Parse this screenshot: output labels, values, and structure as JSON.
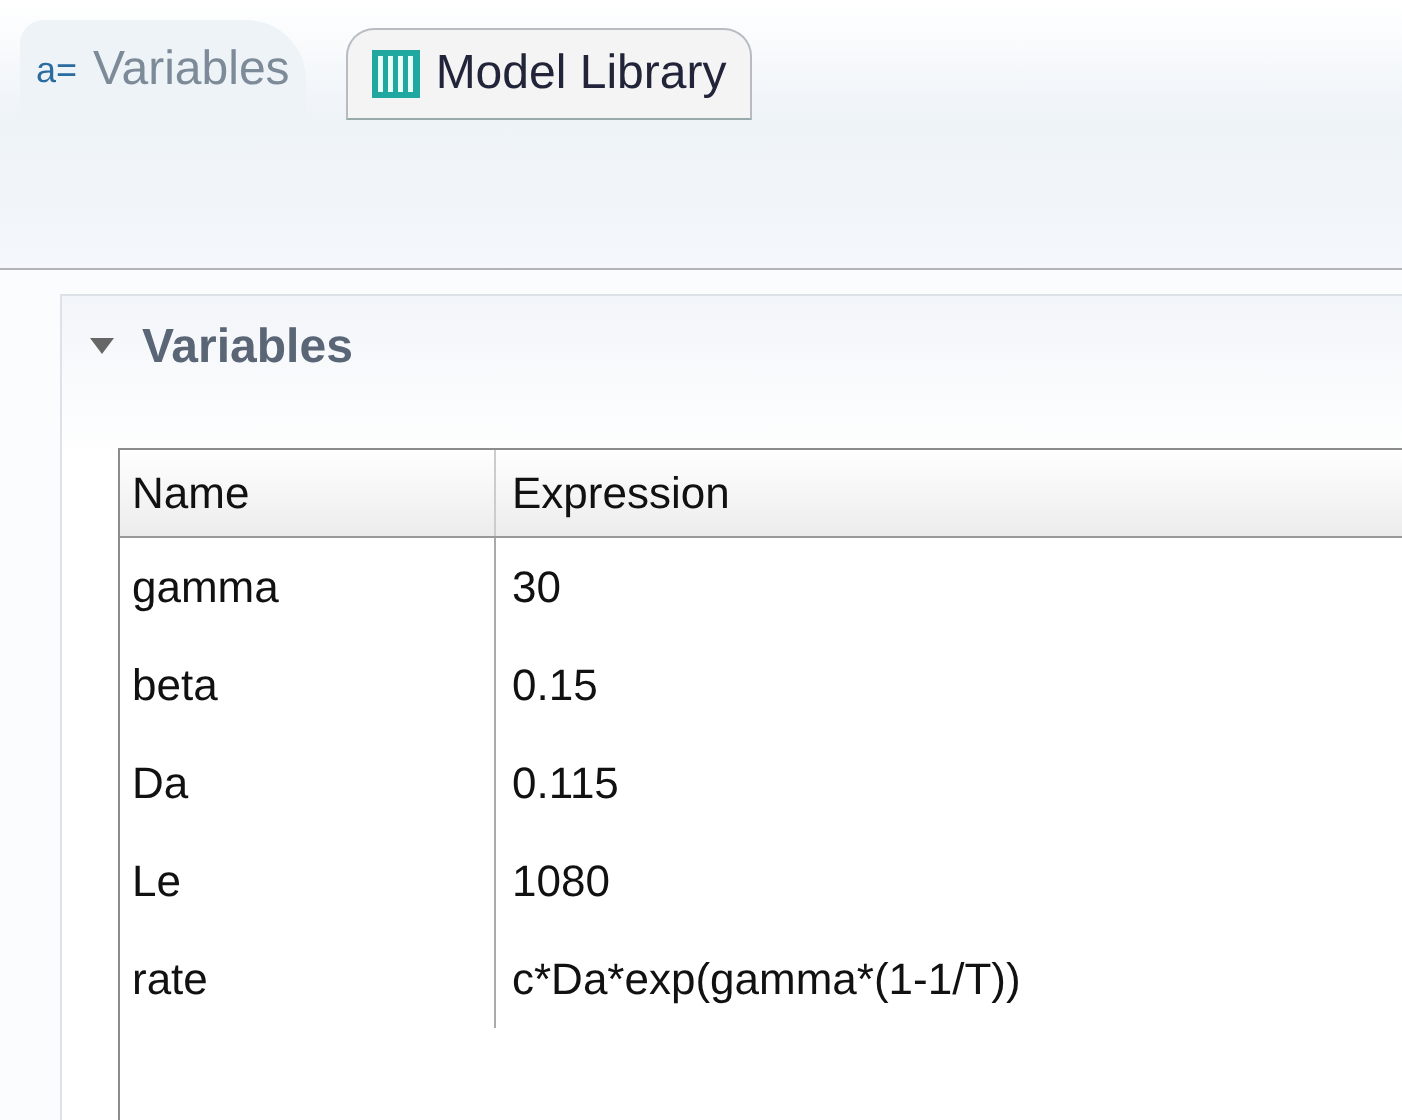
{
  "tabs": [
    {
      "kind": "variables",
      "icon_text": "a=",
      "label": "Variables",
      "selected": true
    },
    {
      "kind": "library",
      "label": "Model Library",
      "selected": false
    }
  ],
  "section": {
    "title": "Variables",
    "expanded": true
  },
  "table": {
    "columns": [
      "Name",
      "Expression"
    ],
    "rows": [
      [
        "gamma",
        "30"
      ],
      [
        "beta",
        "0.15"
      ],
      [
        "Da",
        "0.115"
      ],
      [
        "Le",
        "1080"
      ],
      [
        "rate",
        "c*Da*exp(gamma*(1-1/T))"
      ]
    ]
  }
}
